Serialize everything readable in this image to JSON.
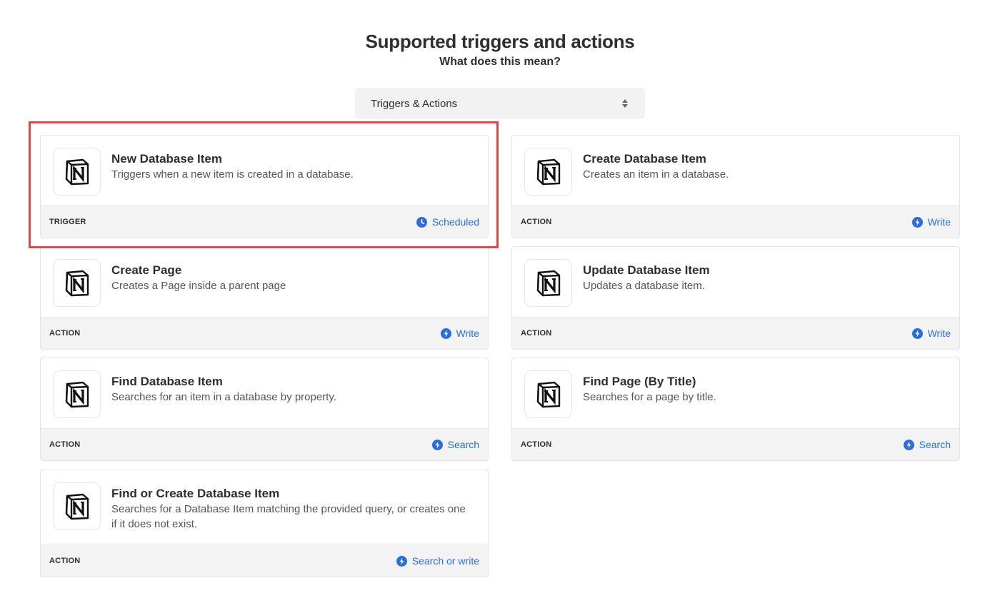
{
  "header": {
    "title": "Supported triggers and actions",
    "subtitle": "What does this mean?"
  },
  "filter": {
    "selected": "Triggers & Actions"
  },
  "colors": {
    "accent": "#2b6fd6",
    "highlight": "#e0474c",
    "footer_bg": "#f3f3f3"
  },
  "cards": [
    {
      "title": "New Database Item",
      "description": "Triggers when a new item is created in a database.",
      "type": "TRIGGER",
      "mode": "Scheduled",
      "mode_icon": "clock-icon",
      "logo": "notion-logo"
    },
    {
      "title": "Create Database Item",
      "description": "Creates an item in a database.",
      "type": "ACTION",
      "mode": "Write",
      "mode_icon": "bolt-icon",
      "logo": "notion-logo"
    },
    {
      "title": "Create Page",
      "description": "Creates a Page inside a parent page",
      "type": "ACTION",
      "mode": "Write",
      "mode_icon": "bolt-icon",
      "logo": "notion-logo"
    },
    {
      "title": "Update Database Item",
      "description": "Updates a database item.",
      "type": "ACTION",
      "mode": "Write",
      "mode_icon": "bolt-icon",
      "logo": "notion-logo"
    },
    {
      "title": "Find Database Item",
      "description": "Searches for an item in a database by property.",
      "type": "ACTION",
      "mode": "Search",
      "mode_icon": "bolt-icon",
      "logo": "notion-logo"
    },
    {
      "title": "Find Page (By Title)",
      "description": "Searches for a page by title.",
      "type": "ACTION",
      "mode": "Search",
      "mode_icon": "bolt-icon",
      "logo": "notion-logo"
    },
    {
      "title": "Find or Create Database Item",
      "description": "Searches for a Database Item matching the provided query, or creates one if it does not exist.",
      "type": "ACTION",
      "mode": "Search or write",
      "mode_icon": "bolt-icon",
      "logo": "notion-logo"
    }
  ]
}
